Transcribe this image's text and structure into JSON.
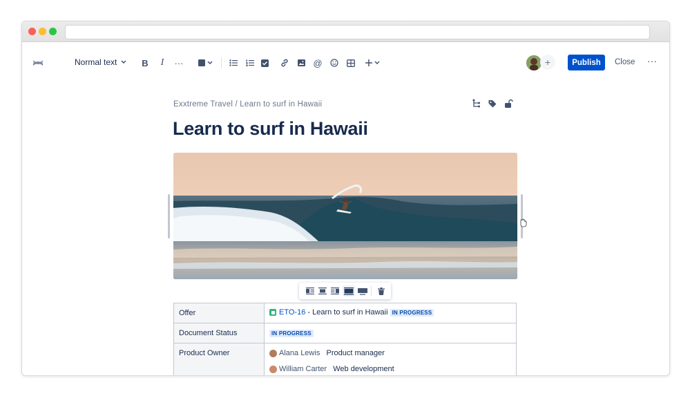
{
  "toolbar": {
    "text_style": "Normal text",
    "publish_label": "Publish",
    "close_label": "Close"
  },
  "page": {
    "breadcrumb": "Exxtreme Travel / Learn to surf in Hawaii",
    "title": "Learn to surf in Hawaii"
  },
  "table": {
    "offer_label": "Offer",
    "offer_issue_key": "ETO-16",
    "offer_issue_title": " - Learn to surf in Hawaii",
    "offer_status": "IN PROGRESS",
    "doc_status_label": "Document Status",
    "doc_status_value": "IN PROGRESS",
    "owner_label": "Product Owner",
    "owners": [
      {
        "name": "Alana Lewis",
        "role": "Product manager"
      },
      {
        "name": "William Carter",
        "role": "Web development"
      }
    ]
  },
  "colors": {
    "primary": "#0052cc",
    "lozenge_bg": "#deebff",
    "lozenge_text": "#0747a6",
    "jira_green": "#36b37e"
  }
}
